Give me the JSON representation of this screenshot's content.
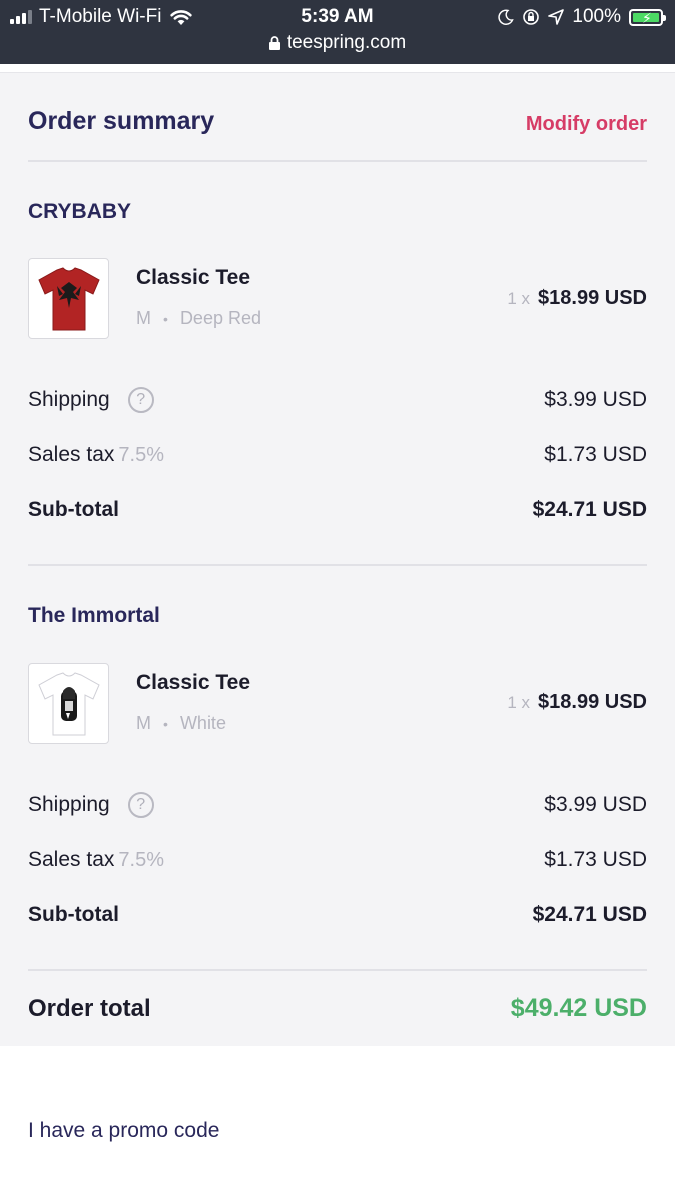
{
  "status_bar": {
    "carrier": "T-Mobile Wi-Fi",
    "time": "5:39 AM",
    "battery": "100%",
    "url": "teespring.com"
  },
  "header": {
    "title": "Order summary",
    "modify_label": "Modify order"
  },
  "colors": {
    "accent": "#d63c66",
    "heading": "#29275a",
    "total": "#4caf6a"
  },
  "orders": [
    {
      "campaign": "CRYBABY",
      "product": "Classic Tee",
      "size": "M",
      "separator": "•",
      "color": "Deep Red",
      "qty": "1 x",
      "price": "$18.99 USD",
      "shipping_label": "Shipping",
      "shipping_help": "?",
      "shipping": "$3.99 USD",
      "tax_label": "Sales tax",
      "tax_rate": "7.5%",
      "tax": "$1.73 USD",
      "subtotal_label": "Sub-total",
      "subtotal": "$24.71 USD"
    },
    {
      "campaign": "The Immortal",
      "product": "Classic Tee",
      "size": "M",
      "separator": "•",
      "color": "White",
      "qty": "1 x",
      "price": "$18.99 USD",
      "shipping_label": "Shipping",
      "shipping_help": "?",
      "shipping": "$3.99 USD",
      "tax_label": "Sales tax",
      "tax_rate": "7.5%",
      "tax": "$1.73 USD",
      "subtotal_label": "Sub-total",
      "subtotal": "$24.71 USD"
    }
  ],
  "total": {
    "label": "Order total",
    "value": "$49.42 USD"
  },
  "promo_label": "I have a promo code"
}
